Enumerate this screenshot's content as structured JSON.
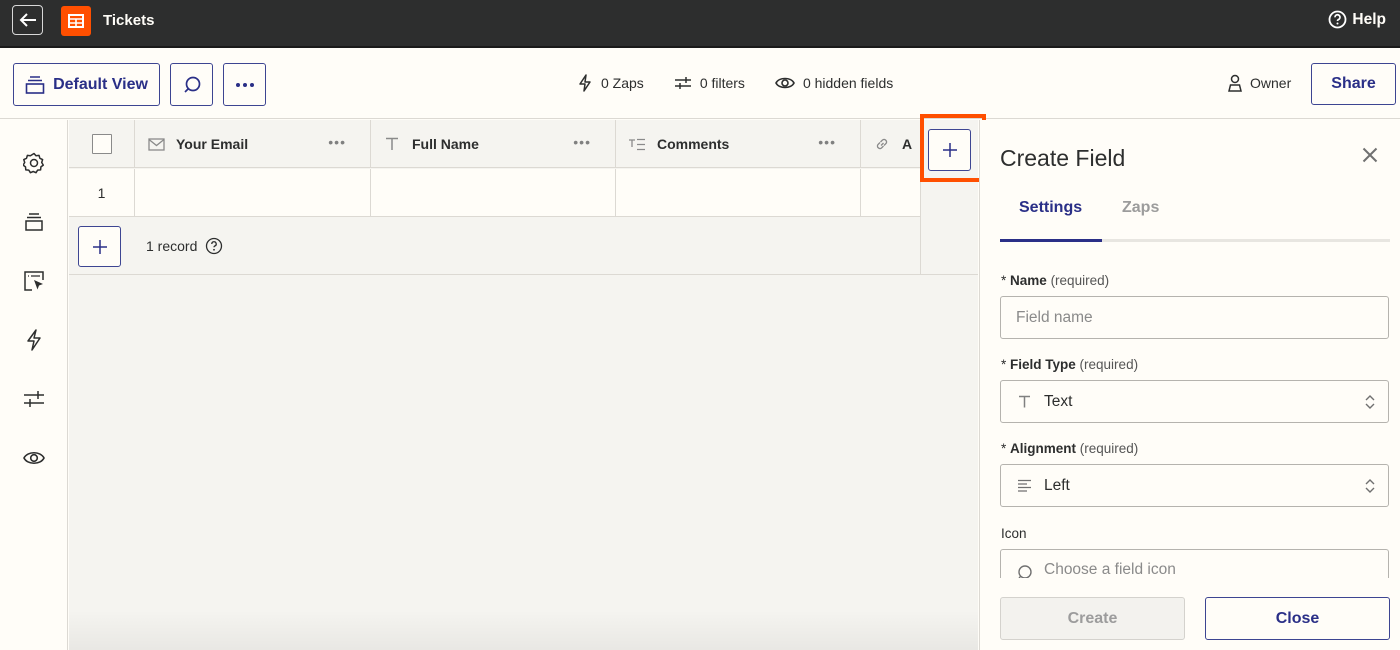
{
  "app": {
    "title": "Tickets",
    "help_label": "Help",
    "accent_color": "#ff4f00",
    "brand_blue": "#2a2f87"
  },
  "toolbar": {
    "view_label": "Default View",
    "stats": [
      {
        "icon": "lightning-icon",
        "label": "0 Zaps"
      },
      {
        "icon": "filter-icon",
        "label": "0 filters"
      },
      {
        "icon": "eye-icon",
        "label": "0 hidden fields"
      }
    ],
    "owner_label": "Owner",
    "share_label": "Share"
  },
  "rail": {
    "items": [
      {
        "icon": "gear-icon",
        "label": "Settings"
      },
      {
        "icon": "views-icon",
        "label": "Views"
      },
      {
        "icon": "interface-icon",
        "label": "Interfaces"
      },
      {
        "icon": "lightning-icon",
        "label": "Zaps"
      },
      {
        "icon": "filter-icon",
        "label": "Filters"
      },
      {
        "icon": "eye-icon",
        "label": "Hidden fields"
      }
    ]
  },
  "table": {
    "columns": [
      {
        "icon": "mail-icon",
        "label": "Your Email"
      },
      {
        "icon": "text-icon",
        "label": "Full Name"
      },
      {
        "icon": "long-text-icon",
        "label": "Comments"
      },
      {
        "icon": "link-icon",
        "label": "A"
      }
    ],
    "rows": [
      {
        "index": "1",
        "cells": [
          "",
          "",
          "",
          ""
        ]
      }
    ],
    "record_count": "1 record"
  },
  "panel": {
    "title": "Create Field",
    "tabs": [
      {
        "label": "Settings",
        "active": true
      },
      {
        "label": "Zaps",
        "active": false
      }
    ],
    "fields": {
      "name": {
        "label": "Name",
        "required_note": "(required)",
        "value": "",
        "placeholder": "Field name"
      },
      "field_type": {
        "label": "Field Type",
        "required_note": "(required)",
        "value": "Text"
      },
      "alignment": {
        "label": "Alignment",
        "required_note": "(required)",
        "value": "Left"
      },
      "icon": {
        "label": "Icon",
        "placeholder": "Choose a field icon"
      }
    },
    "create_label": "Create",
    "close_label": "Close"
  }
}
